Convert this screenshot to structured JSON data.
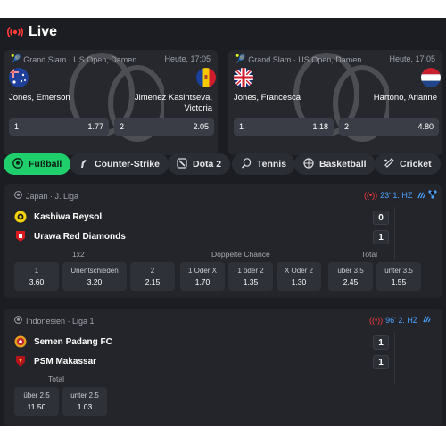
{
  "live": {
    "title": "Live"
  },
  "featured": [
    {
      "competition": "Grand Slam · US Open, Damen",
      "time": "Heute, 17:05",
      "p1": "Jones, Emerson",
      "p2_line1": "Jimenez Kasintseva,",
      "p2_line2": "Victoria",
      "o1_label": "1",
      "o1_value": "1.77",
      "o2_label": "2",
      "o2_value": "2.05"
    },
    {
      "competition": "Grand Slam · US Open, Damen",
      "time": "Heute, 17:05",
      "p1": "Jones, Francesca",
      "p2": "Hartono, Arianne",
      "o1_label": "1",
      "o1_value": "1.18",
      "o2_label": "2",
      "o2_value": "4.80"
    }
  ],
  "sports": [
    {
      "label": "Fußball",
      "icon": "soccer-ball-icon"
    },
    {
      "label": "Counter-Strike",
      "icon": "cs-icon"
    },
    {
      "label": "Dota 2",
      "icon": "dota-icon"
    },
    {
      "label": "Tennis",
      "icon": "tennis-icon"
    },
    {
      "label": "Basketball",
      "icon": "basketball-icon"
    },
    {
      "label": "Cricket",
      "icon": "cricket-icon"
    }
  ],
  "events": [
    {
      "league": "Japan · J. Liga",
      "status": "23' 1. HZ",
      "home": "Kashiwa Reysol",
      "away": "Urawa Red Diamonds",
      "home_score": "0",
      "away_score": "1",
      "market_1x2": "1x2",
      "market_dc": "Doppelte Chance",
      "market_total": "Total",
      "odds": [
        {
          "label": "1",
          "value": "3.60"
        },
        {
          "label": "Unentschieden",
          "value": "3.20"
        },
        {
          "label": "2",
          "value": "2.15"
        },
        {
          "label": "1 Oder X",
          "value": "1.70"
        },
        {
          "label": "1 oder 2",
          "value": "1.35"
        },
        {
          "label": "X Oder 2",
          "value": "1.30"
        },
        {
          "label": "über 3.5",
          "value": "2.45"
        },
        {
          "label": "unter 3.5",
          "value": "1.55"
        }
      ]
    },
    {
      "league": "Indonesien · Liga 1",
      "status": "96' 2. HZ",
      "home": "Semen Padang FC",
      "away": "PSM Makassar",
      "home_score": "1",
      "away_score": "1",
      "market_total": "Total",
      "odds": [
        {
          "label": "über 2.5",
          "value": "11.50"
        },
        {
          "label": "unter 2.5",
          "value": "1.03"
        }
      ]
    }
  ],
  "colors": {
    "accent": "#1fcf6b",
    "live_red": "#ff3b3b",
    "status_blue": "#4aa3ff"
  }
}
